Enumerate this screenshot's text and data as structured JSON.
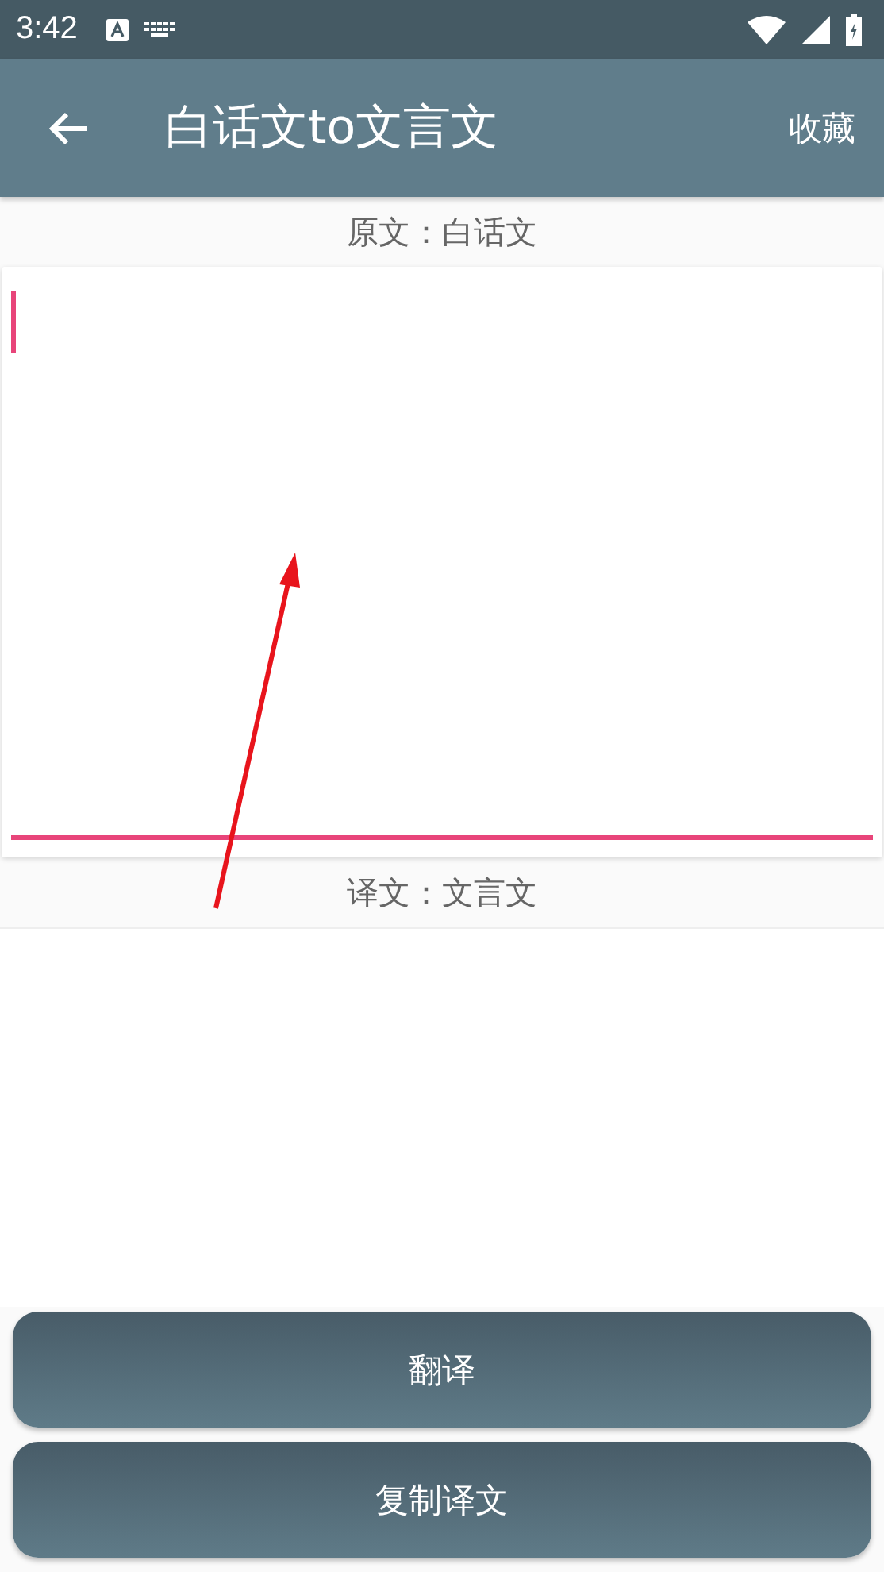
{
  "status_bar": {
    "time": "3:42"
  },
  "app_bar": {
    "title": "白话文to文言文",
    "action": "收藏"
  },
  "source": {
    "label": "原文：白话文",
    "focused": true
  },
  "result": {
    "label": "译文：文言文"
  },
  "buttons": [
    "翻译",
    "复制译文"
  ]
}
